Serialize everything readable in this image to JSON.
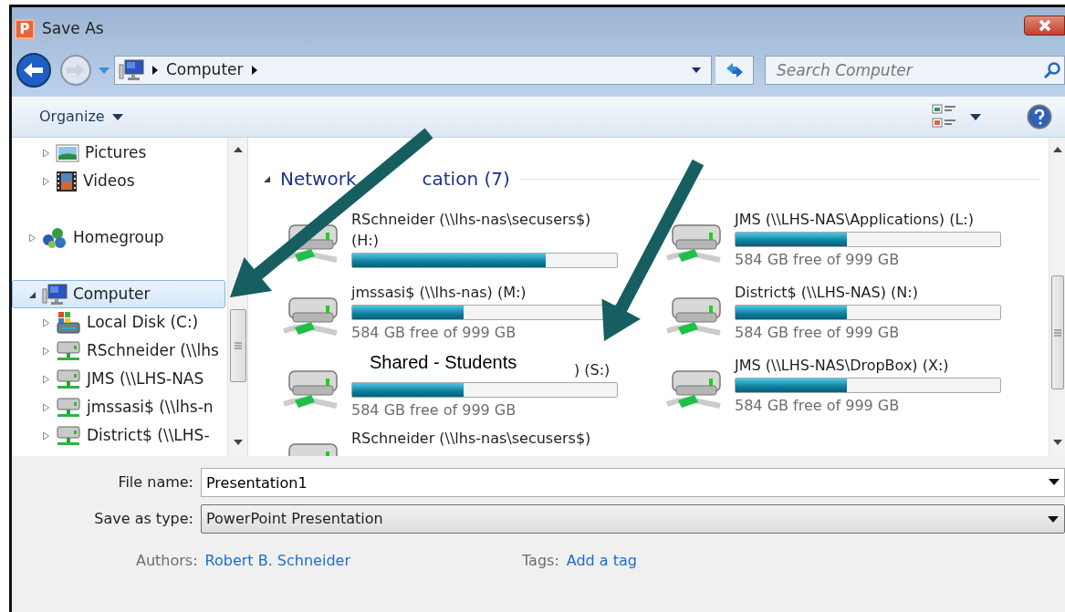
{
  "window": {
    "title": "Save As",
    "app_icon_letter": "P"
  },
  "address_bar": {
    "breadcrumbs": [
      "Computer"
    ],
    "search": {
      "placeholder": "Search Computer"
    }
  },
  "toolbar": {
    "organize": "Organize"
  },
  "sidebar": {
    "groups": [
      {
        "kind": "sublist",
        "items": [
          {
            "label": "Pictures",
            "kind": "pictures",
            "expanded": false,
            "selected": false
          },
          {
            "label": "Videos",
            "kind": "videos",
            "expanded": false,
            "selected": false
          }
        ]
      },
      {
        "kind": "root",
        "items": [
          {
            "label": "Homegroup",
            "kind": "homegroup",
            "expanded": false,
            "selected": false
          }
        ]
      },
      {
        "kind": "root",
        "items": [
          {
            "label": "Computer",
            "kind": "computer",
            "expanded": true,
            "selected": true,
            "children": [
              {
                "label": "Local Disk (C:)",
                "kind": "disk",
                "expanded": false,
                "selected": false
              },
              {
                "label": "RSchneider (\\\\lhs",
                "kind": "network",
                "expanded": false,
                "selected": false
              },
              {
                "label": "JMS (\\\\LHS-NAS",
                "kind": "network",
                "expanded": false,
                "selected": false
              },
              {
                "label": "jmssasi$ (\\\\lhs-n",
                "kind": "network",
                "expanded": false,
                "selected": false
              },
              {
                "label": "District$ (\\\\LHS-",
                "kind": "network",
                "expanded": false,
                "selected": false
              }
            ]
          }
        ]
      }
    ]
  },
  "content": {
    "section": {
      "title_parts": [
        "Network",
        "cation (7)"
      ],
      "expanded": true
    },
    "drives": [
      {
        "name": "RSchneider (\\\\lhs-nas\\secusers$) (H:)",
        "level": 0.73
      },
      {
        "name": "JMS (\\\\LHS-NAS\\Applications) (L:)",
        "level": 0.42,
        "reading": "584 GB free of 999 GB"
      },
      {
        "name": "jmssasi$ (\\\\lhs-nas) (M:)",
        "level": 0.42,
        "reading": "584 GB free of 999 GB"
      },
      {
        "name": "District$ (\\\\LHS-NAS) (N:)",
        "level": 0.42,
        "reading": "584 GB free of 999 GB"
      },
      {
        "callout": "Shared - Students",
        "name": ") (S:)",
        "level": 0.42,
        "reading": "584 GB free of 999 GB"
      },
      {
        "name": "JMS (\\\\LHS-NAS\\DropBox) (X:)",
        "level": 0.42,
        "reading": "584 GB free of 999 GB"
      },
      {
        "name": "RSchneider (\\\\lhs-nas\\secusers$)"
      }
    ]
  },
  "form": {
    "file_name": {
      "label": "File name:",
      "value": "Presentation1"
    },
    "save_type": {
      "label": "Save as type:",
      "value": "PowerPoint Presentation"
    },
    "meta": [
      {
        "label": "Authors:",
        "value": "Robert B. Schneider"
      },
      {
        "label": "Tags:",
        "value": "Add a tag"
      }
    ]
  }
}
